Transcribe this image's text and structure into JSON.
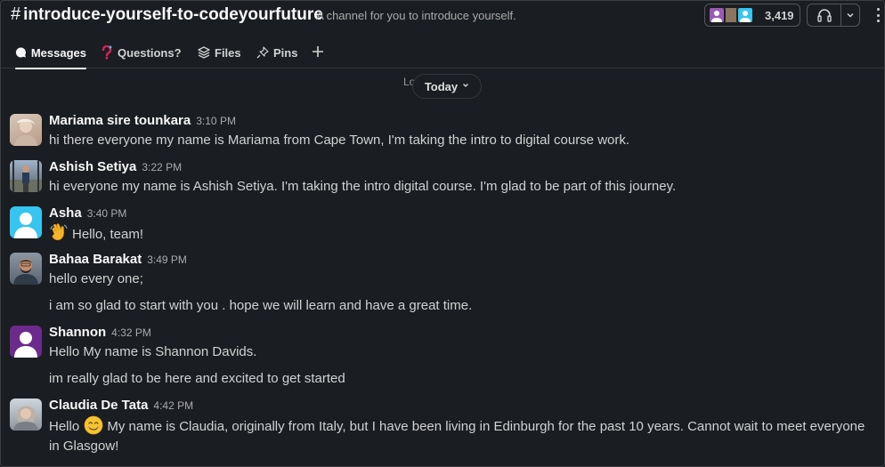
{
  "channel": {
    "name": "introduce-yourself-to-codeyourfuture",
    "description": "A channel for you to introduce yourself.",
    "member_count": "3,419"
  },
  "tabs": [
    {
      "label": "Messages",
      "icon": "chat-bubble-icon"
    },
    {
      "label": "Questions?",
      "icon": "question-mark-icon"
    },
    {
      "label": "Files",
      "icon": "layers-icon"
    },
    {
      "label": "Pins",
      "icon": "pin-icon"
    }
  ],
  "loading_text": "Lo...",
  "day_divider": "Today",
  "messages": [
    {
      "sender": "Mariama sire tounkara",
      "time": "3:10 PM",
      "lines": [
        "hi there everyone my name is Mariama from Cape Town, I'm taking the intro to digital course work."
      ]
    },
    {
      "sender": "Ashish Setiya",
      "time": "3:22 PM",
      "lines": [
        "hi everyone my name is Ashish Setiya. I'm taking the intro digital course. I'm glad to be part of this journey."
      ]
    },
    {
      "sender": "Asha",
      "time": "3:40 PM",
      "lines": [
        "Hello, team!"
      ],
      "emoji": "waving-hand"
    },
    {
      "sender": "Bahaa Barakat",
      "time": "3:49 PM",
      "lines": [
        "hello every one;",
        "i am so glad to start with you .  hope we will learn and have a great time."
      ]
    },
    {
      "sender": "Shannon",
      "time": "4:32 PM",
      "lines": [
        "Hello My name is Shannon Davids.",
        "im really glad to be here and excited to get started"
      ]
    },
    {
      "sender": "Claudia De Tata",
      "time": "4:42 PM",
      "lines": [
        "Hello",
        "My name is Claudia, originally from Italy, but I have been living in Edinburgh for the past 10 years. Cannot wait to meet everyone in Glasgow!"
      ],
      "emoji": "smiling-face"
    }
  ],
  "colors": {
    "background": "#1a1d21",
    "default_avatar_blue": "#36c5f0",
    "default_avatar_purple": "#6c2a8c"
  }
}
